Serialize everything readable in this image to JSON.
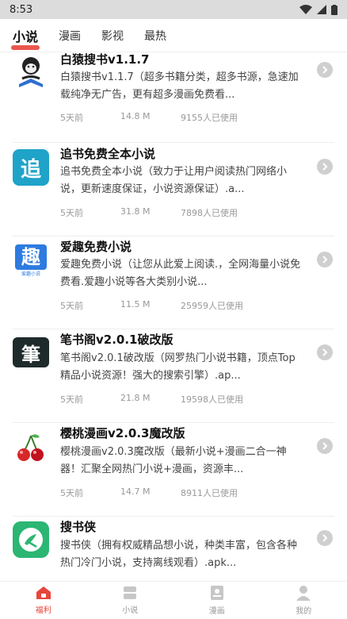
{
  "status": {
    "time": "8:53"
  },
  "tabs": [
    {
      "label": "小说",
      "active": true
    },
    {
      "label": "漫画",
      "active": false
    },
    {
      "label": "影视",
      "active": false
    },
    {
      "label": "最热",
      "active": false
    }
  ],
  "apps": [
    {
      "title": "白猿搜书v1.1.7",
      "desc": "白猿搜书v1.1.7（超多书籍分类，超多书源，急速加载纯净无广告，更有超多漫画免费看...",
      "time": "5天前",
      "size": "14.8 M",
      "users": "9155人已使用",
      "icon": "ape-reading-icon"
    },
    {
      "title": "追书免费全本小说",
      "desc": "追书免费全本小说（致力于让用户阅读热门网络小说，更新速度保证，小说资源保证）.a...",
      "time": "5天前",
      "size": "31.8 M",
      "users": "7898人已使用",
      "icon": "zhui-logo-icon",
      "logo_text": "追"
    },
    {
      "title": "爱趣免费小说",
      "desc": "爱趣免费小说（让您从此爱上阅读.，全网海量小说免费看.爱趣小说等各大类别小说...",
      "time": "5天前",
      "size": "11.5 M",
      "users": "25959人已使用",
      "icon": "aiqu-logo-icon",
      "logo_text": "趣",
      "logo_sub": "爱趣小说"
    },
    {
      "title": "笔书阁v2.0.1破改版",
      "desc": "笔书阁v2.0.1破改版（网罗热门小说书籍，顶点Top精品小说资源！强大的搜索引擎）.ap...",
      "time": "5天前",
      "size": "21.8 M",
      "users": "19598人已使用",
      "icon": "bishuge-logo-icon",
      "logo_text": "筆"
    },
    {
      "title": "樱桃漫画v2.0.3魔改版",
      "desc": "樱桃漫画v2.0.3魔改版（最新小说+漫画二合一神器！汇聚全网热门小说+漫画，资源丰...",
      "time": "5天前",
      "size": "14.7 M",
      "users": "8911人已使用",
      "icon": "cherry-icon"
    },
    {
      "title": "搜书侠",
      "desc": "搜书侠（拥有权威精品想小说，种类丰富，包含各种热门冷门小说，支持离线观看）.apk...",
      "time": "",
      "size": "",
      "users": "",
      "icon": "soushuxia-logo-icon"
    }
  ],
  "bottom_nav": [
    {
      "label": "福利",
      "icon": "home-icon",
      "active": true
    },
    {
      "label": "小说",
      "icon": "book-stack-icon",
      "active": false
    },
    {
      "label": "漫画",
      "icon": "comic-icon",
      "active": false
    },
    {
      "label": "我的",
      "icon": "person-icon",
      "active": false
    }
  ],
  "colors": {
    "accent": "#e8453c",
    "zhui": "#1fa3c9",
    "aiqu": "#2d7be0",
    "bishuge": "#1f2b2b",
    "soushuxia": "#2bb673"
  }
}
